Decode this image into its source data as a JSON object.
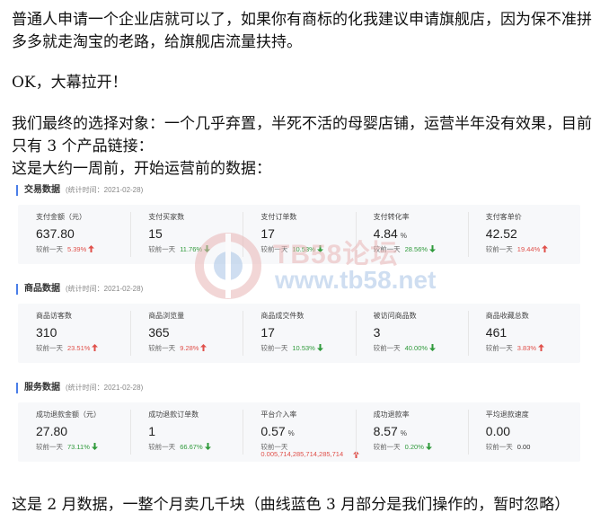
{
  "text": {
    "p1": "普通人申请一个企业店就可以了，如果你有商标的化我建议申请旗舰店，因为保不准拼多多就走淘宝的老路，给旗舰店流量扶持。",
    "p2": "OK，大幕拉开！",
    "p3": "我们最终的选择对象：一个几乎弃置，半死不活的母婴店铺，运营半年没有效果，目前只有 3 个产品链接：",
    "p4": "这是大约一周前，开始运营前的数据：",
    "p5": "这是 2 月数据，一整个月卖几千块（曲线蓝色 3 月部分是我们操作的，暂时忽略）"
  },
  "watermark": {
    "line1": "TB58论坛",
    "line2": "www.tb58.net"
  },
  "sections": [
    {
      "title": "交易数据",
      "time": "(统计时间：2021-02-28)",
      "metrics": [
        {
          "label": "支付金额（元）",
          "value": "637.80",
          "unit": "",
          "compare": "较前一天",
          "pct": "5.39%",
          "dir": "up"
        },
        {
          "label": "支付买家数",
          "value": "15",
          "unit": "",
          "compare": "较前一天",
          "pct": "11.76%",
          "dir": "down"
        },
        {
          "label": "支付订单数",
          "value": "17",
          "unit": "",
          "compare": "较前一天",
          "pct": "10.53%",
          "dir": "down"
        },
        {
          "label": "支付转化率",
          "value": "4.84",
          "unit": "%",
          "compare": "较前一天",
          "pct": "28.56%",
          "dir": "down"
        },
        {
          "label": "支付客单价",
          "value": "42.52",
          "unit": "",
          "compare": "较前一天",
          "pct": "19.44%",
          "dir": "up"
        }
      ]
    },
    {
      "title": "商品数据",
      "time": "(统计时间：2021-02-28)",
      "metrics": [
        {
          "label": "商品访客数",
          "value": "310",
          "unit": "",
          "compare": "较前一天",
          "pct": "23.51%",
          "dir": "up"
        },
        {
          "label": "商品浏览量",
          "value": "365",
          "unit": "",
          "compare": "较前一天",
          "pct": "9.28%",
          "dir": "up"
        },
        {
          "label": "商品成交件数",
          "value": "17",
          "unit": "",
          "compare": "较前一天",
          "pct": "10.53%",
          "dir": "down"
        },
        {
          "label": "被访问商品数",
          "value": "3",
          "unit": "",
          "compare": "较前一天",
          "pct": "40.00%",
          "dir": "down"
        },
        {
          "label": "商品收藏总数",
          "value": "461",
          "unit": "",
          "compare": "较前一天",
          "pct": "3.83%",
          "dir": "up"
        }
      ]
    },
    {
      "title": "服务数据",
      "time": "(统计时间：2021-02-28)",
      "metrics": [
        {
          "label": "成功退款金额（元）",
          "value": "27.80",
          "unit": "",
          "compare": "较前一天",
          "pct": "73.11%",
          "dir": "down"
        },
        {
          "label": "成功退款订单数",
          "value": "1",
          "unit": "",
          "compare": "较前一天",
          "pct": "66.67%",
          "dir": "down"
        },
        {
          "label": "平台介入率",
          "value": "0.57",
          "unit": "%",
          "compare": "较前一天",
          "pct": "",
          "dir": "",
          "extra": "0.005,714,285,714,285,714"
        },
        {
          "label": "成功退款率",
          "value": "8.57",
          "unit": "%",
          "compare": "较前一天",
          "pct": "0.20%",
          "dir": "down"
        },
        {
          "label": "平均退款速度",
          "value": "0.00",
          "unit": "",
          "compare": "较前一天",
          "pct": "0.00",
          "dir": "plain"
        }
      ]
    }
  ],
  "colors": {
    "accent": "#4a7ee8",
    "up": "#e0504a",
    "down": "#2f9a3b"
  }
}
